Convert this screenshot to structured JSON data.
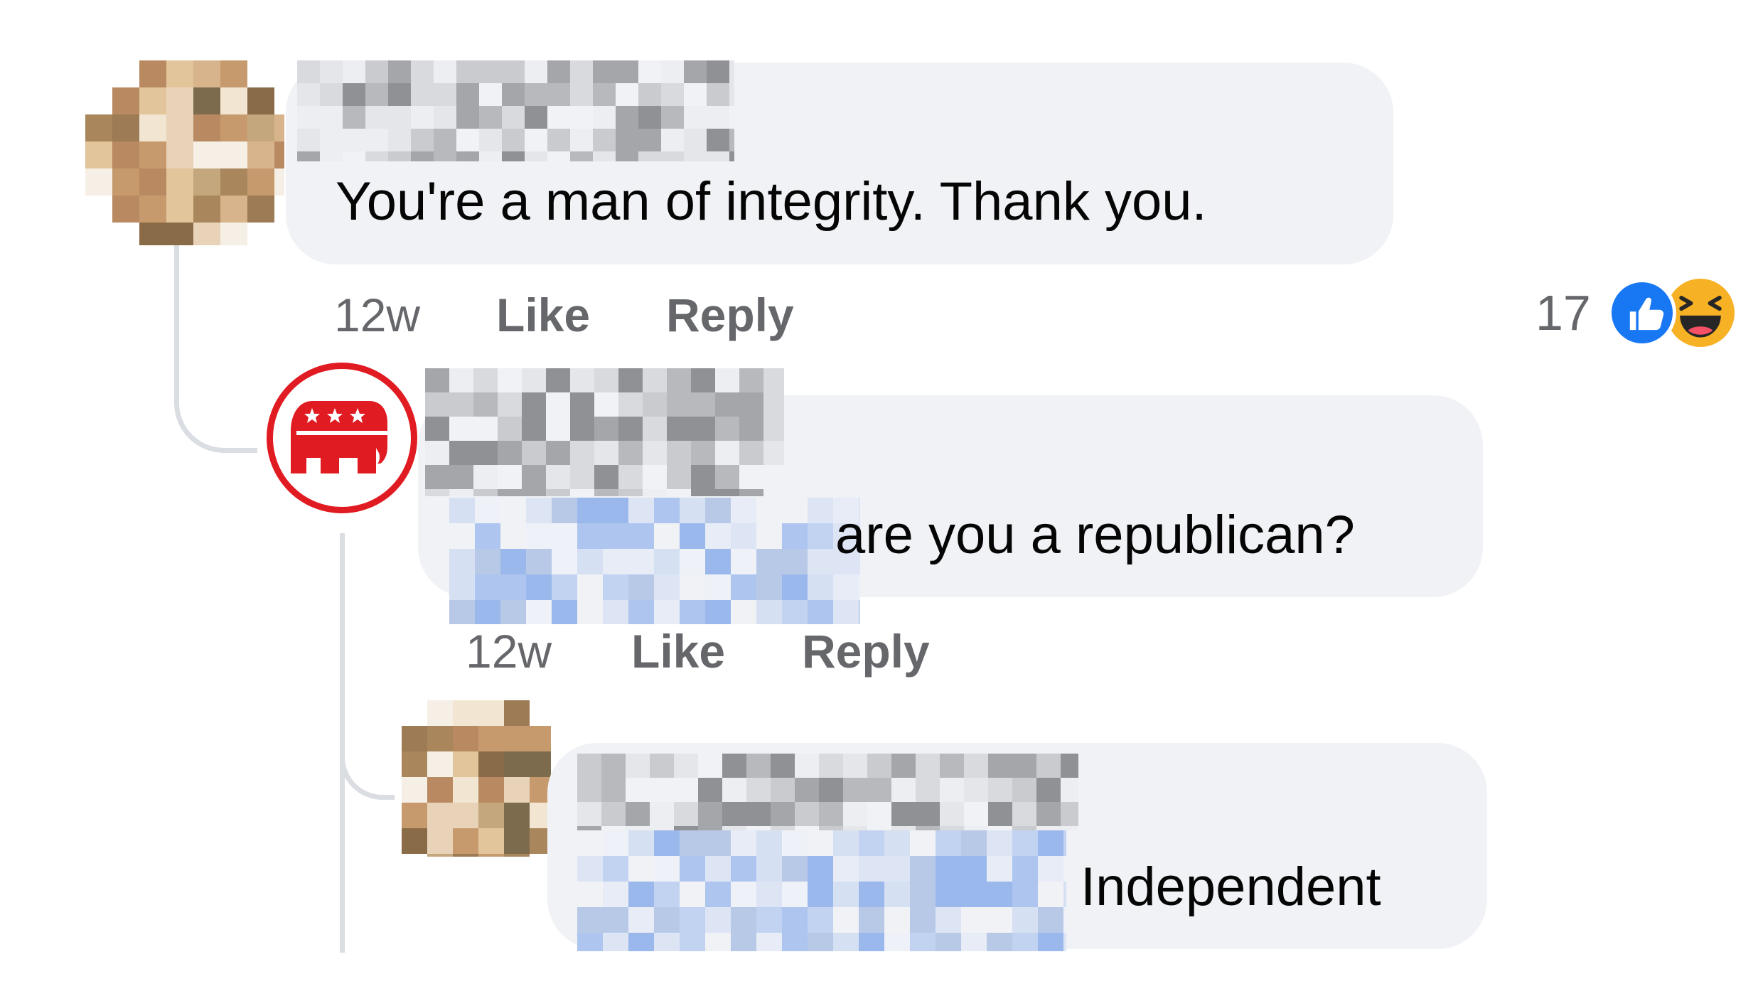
{
  "comments": [
    {
      "text": "You're a man of integrity. Thank you.",
      "timestamp": "12w",
      "like_label": "Like",
      "reply_label": "Reply",
      "reaction_count": "17",
      "reactions": [
        "like-icon",
        "haha-icon"
      ]
    },
    {
      "text": "are you a republican?",
      "timestamp": "12w",
      "like_label": "Like",
      "reply_label": "Reply",
      "avatar": "republican-elephant-icon"
    },
    {
      "text": "Independent"
    }
  ],
  "colors": {
    "bubble": "#f0f2f5",
    "meta_text": "#65676b",
    "like_blue": "#1877f2",
    "haha_yellow": "#f7b125",
    "gop_red": "#e11b22",
    "thread_line": "#dadde1"
  }
}
